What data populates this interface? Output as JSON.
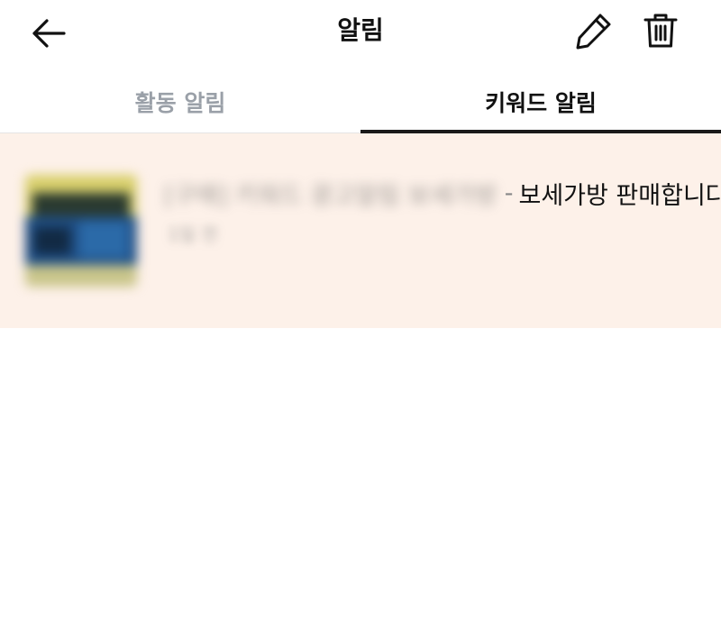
{
  "header": {
    "title": "알림",
    "back_icon": "arrow-left-icon",
    "edit_icon": "pencil-icon",
    "delete_icon": "trash-icon"
  },
  "tabs": [
    {
      "label": "활동 알림",
      "active": false
    },
    {
      "label": "키워드 알림",
      "active": true
    }
  ],
  "notifications": [
    {
      "keyword": "[구매] 키워드 광고알림 보세가방",
      "separator": "-",
      "message": "보세가방 판매합니다.",
      "date": "1일 전",
      "thumbnail_icon": "product-thumbnail"
    }
  ],
  "colors": {
    "highlight_background": "#fdf1e9",
    "active_tab_indicator": "#1a1a1a",
    "inactive_tab_text": "#9aa0a8"
  }
}
